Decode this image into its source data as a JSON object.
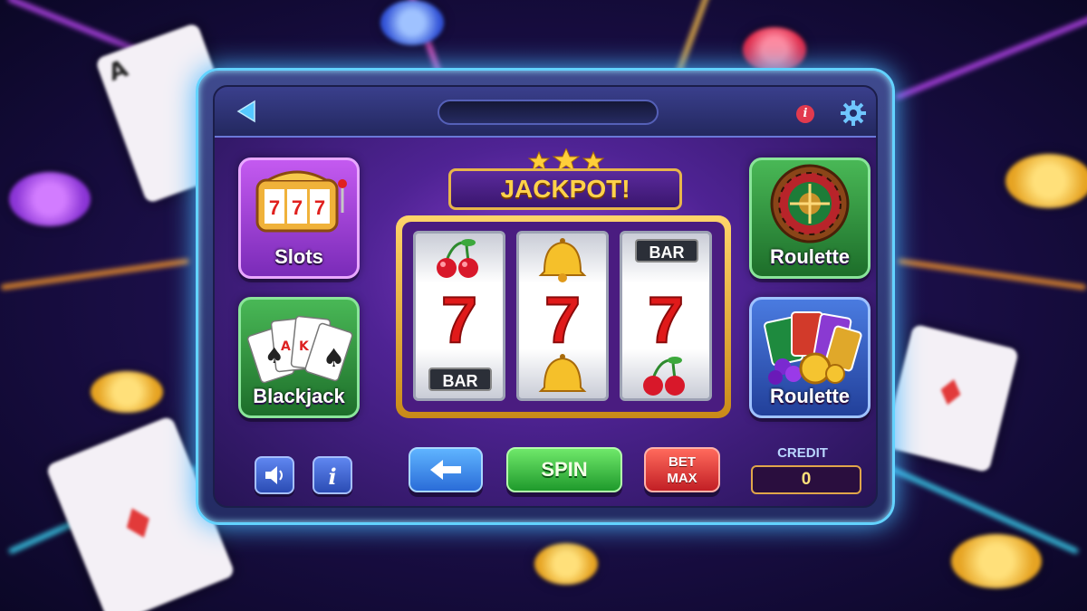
{
  "header": {
    "back_icon": "back-arrow-icon",
    "info_label": "i",
    "settings_icon": "gear-icon"
  },
  "games": [
    {
      "label": "Slots",
      "icon": "slot-machine-icon",
      "color": "#b24be6"
    },
    {
      "label": "Blackjack",
      "icon": "playing-cards-icon",
      "color": "#2f9a3e"
    },
    {
      "label": "Roulette",
      "icon": "roulette-wheel-icon",
      "color": "#2f9a3e"
    },
    {
      "label": "Roulette",
      "icon": "chips-and-cards-icon",
      "color": "#3561c8"
    }
  ],
  "machine": {
    "banner": "JACKPOT!",
    "reels": [
      {
        "top": "cherry",
        "middle": "7",
        "bottom": "BAR"
      },
      {
        "top": "bell",
        "middle": "7",
        "bottom": "bell"
      },
      {
        "top": "BAR",
        "middle": "7",
        "bottom": "cherry"
      }
    ]
  },
  "controls": {
    "back_icon": "left-arrow-icon",
    "spin_label": "SPIN",
    "bet_max_line1": "BET",
    "bet_max_line2": "MAX",
    "sound_icon": "speaker-icon",
    "info_icon": "info-icon",
    "credit_label": "CREDIT",
    "credit_value": "0"
  },
  "colors": {
    "accent_gold": "#e8b64a",
    "frame_glow": "#63d3ff",
    "spin_green": "#2fb43a",
    "bet_red": "#d72c2c"
  }
}
